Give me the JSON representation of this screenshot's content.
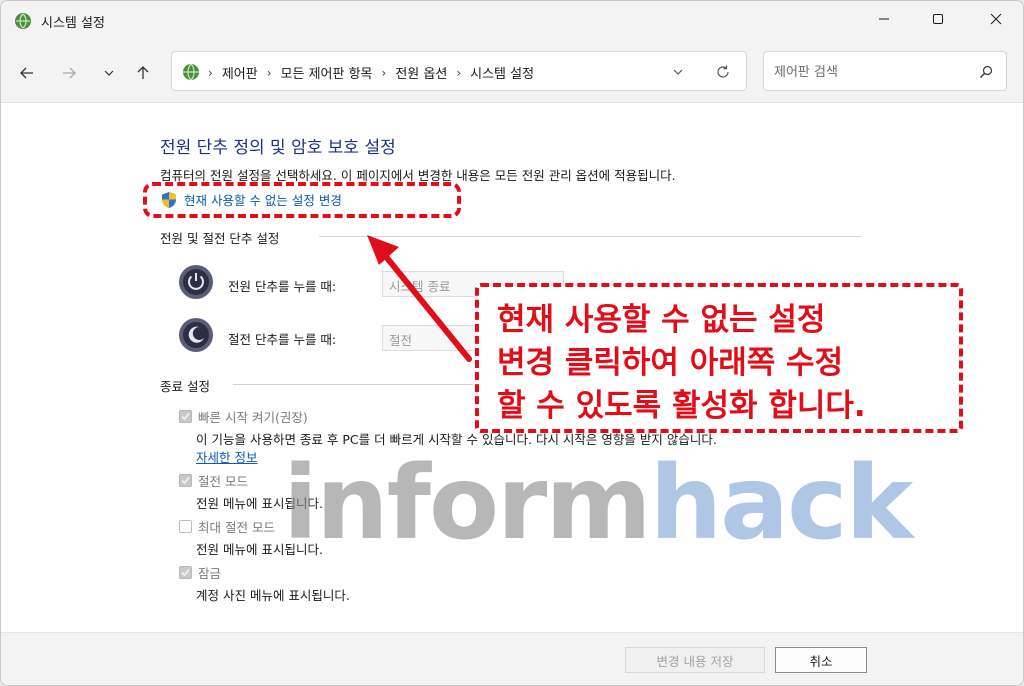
{
  "window": {
    "title": "시스템 설정"
  },
  "navigation": {
    "breadcrumbs": [
      "제어판",
      "모든 제어판 항목",
      "전원 옵션",
      "시스템 설정"
    ],
    "search_placeholder": "제어판 검색"
  },
  "main": {
    "title": "전원 단추 정의 및 암호 보호 설정",
    "description": "컴퓨터의 전원 설정을 선택하세요. 이 페이지에서 변경한 내용은 모든 전원 관리 옵션에 적용됩니다.",
    "change_unavailable_link": "현재 사용할 수 없는 설정 변경",
    "power_section": {
      "header": "전원 및 절전 단추 설정",
      "power_button": {
        "label": "전원 단추를 누를 때:",
        "value": "시스템 종료"
      },
      "sleep_button": {
        "label": "절전 단추를 누를 때:",
        "value": "절전"
      }
    },
    "shutdown_section": {
      "header": "종료 설정",
      "options": [
        {
          "label": "빠른 시작 켜기(권장)",
          "checked": true,
          "desc": "이 기능을 사용하면 종료 후 PC를 더 빠르게 시작할 수 있습니다. 다시 시작은 영향을 받지 않습니다.",
          "link": "자세한 정보"
        },
        {
          "label": "절전 모드",
          "checked": true,
          "desc": "전원 메뉴에 표시됩니다."
        },
        {
          "label": "최대 절전 모드",
          "checked": false,
          "desc": "전원 메뉴에 표시됩니다."
        },
        {
          "label": "잠금",
          "checked": true,
          "desc": "계정 사진 메뉴에 표시됩니다."
        }
      ]
    }
  },
  "footer": {
    "save_label": "변경 내용 저장",
    "cancel_label": "취소"
  },
  "annotation": {
    "callout_text": "현재 사용할 수 없는 설정\n변경 클릭하여 아래쪽 수정\n할 수 있도록 활성화 합니다.",
    "watermark_part1": "inform",
    "watermark_part2": "hack",
    "color": "#e10e1a"
  }
}
